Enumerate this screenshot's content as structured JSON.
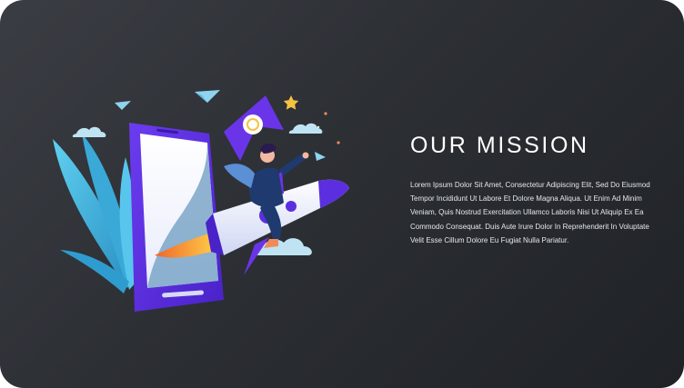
{
  "mission": {
    "title": "OUR MISSION",
    "body": "Lorem Ipsum Dolor Sit Amet, Consectetur Adipiscing Elit, Sed Do Eiusmod Tempor Incididunt Ut Labore Et Dolore Magna Aliqua. Ut Enim Ad Minim Veniam, Quis Nostrud Exercitation Ullamco Laboris Nisi Ut Aliquip Ex Ea Commodo Consequat. Duis Aute Irure Dolor In Reprehenderit In Voluptate Velit Esse Cillum Dolore Eu Fugiat Nulla Pariatur."
  },
  "illustration": {
    "name": "rocket-launch-illustration",
    "colors": {
      "background_top": "#3a3d43",
      "background_bottom": "#1f2226",
      "phone": "#5b2fe0",
      "leaves": "#3bb6e0",
      "rocket_body": "#eef1fb",
      "rocket_accent": "#5b2fe0",
      "flame": "#f59a2f",
      "cloud": "#bfe3f2",
      "flag": "#6a35e8",
      "star": "#f5c242"
    }
  }
}
